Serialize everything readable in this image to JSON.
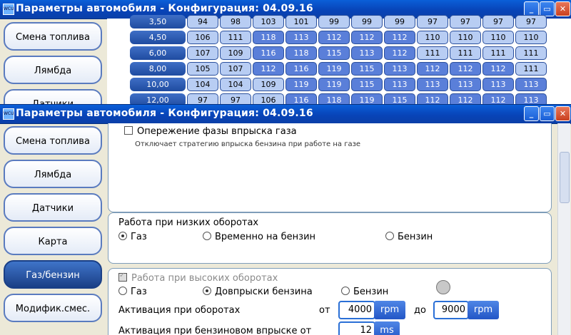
{
  "window_back": {
    "title": "Параметры автомобиля - Конфигурация: 04.09.16",
    "nav": [
      "Смена топлива",
      "Лямбда",
      "Датчики"
    ],
    "rows": [
      {
        "label": "3,50",
        "cells": [
          "94",
          "98",
          "103",
          "101",
          "99",
          "99",
          "99",
          "97",
          "97",
          "97",
          "97"
        ]
      },
      {
        "label": "4,50",
        "cells": [
          "106",
          "111",
          "118",
          "113",
          "112",
          "112",
          "112",
          "110",
          "110",
          "110",
          "110"
        ]
      },
      {
        "label": "6,00",
        "cells": [
          "107",
          "109",
          "116",
          "118",
          "115",
          "113",
          "112",
          "111",
          "111",
          "111",
          "111"
        ]
      },
      {
        "label": "8,00",
        "cells": [
          "105",
          "107",
          "112",
          "116",
          "119",
          "115",
          "113",
          "112",
          "112",
          "112",
          "111"
        ]
      },
      {
        "label": "10,00",
        "cells": [
          "104",
          "104",
          "109",
          "119",
          "119",
          "115",
          "113",
          "113",
          "113",
          "113",
          "113"
        ]
      },
      {
        "label": "12,00",
        "cells": [
          "97",
          "97",
          "106",
          "116",
          "118",
          "119",
          "115",
          "112",
          "112",
          "112",
          "113"
        ]
      }
    ]
  },
  "window_front": {
    "title": "Параметры автомобиля - Конфигурация: 04.09.16",
    "nav": [
      {
        "label": "Смена топлива",
        "active": false
      },
      {
        "label": "Лямбда",
        "active": false
      },
      {
        "label": "Датчики",
        "active": false
      },
      {
        "label": "Карта",
        "active": false
      },
      {
        "label": "Газ/бензин",
        "active": true
      },
      {
        "label": "Модифик.смес.",
        "active": false
      }
    ],
    "injection_phase": {
      "label": "Опережение фазы впрыска газа",
      "description": "Отключает стратегию впрыска бензина при работе на газе"
    },
    "low_rpm": {
      "title": "Работа при низких оборотах",
      "options": [
        "Газ",
        "Временно на бензин",
        "Бензин"
      ],
      "selected": 0
    },
    "high_rpm": {
      "title": "Работа при высоких оборотах",
      "options": [
        "Газ",
        "Довпрыски бензина",
        "Бензин"
      ],
      "selected": 1,
      "activation_rpm_label": "Активация при оборотах",
      "from_label": "от",
      "to_label": "до",
      "rpm_from": "4000",
      "rpm_to": "9000",
      "rpm_unit": "rpm",
      "activation_injection_label": "Активация при бензиновом впрыске от",
      "injection_value": "12",
      "injection_unit": "ms"
    }
  },
  "colors": {
    "accent": "#2356c6",
    "title_bar": "#0a5fd8"
  }
}
